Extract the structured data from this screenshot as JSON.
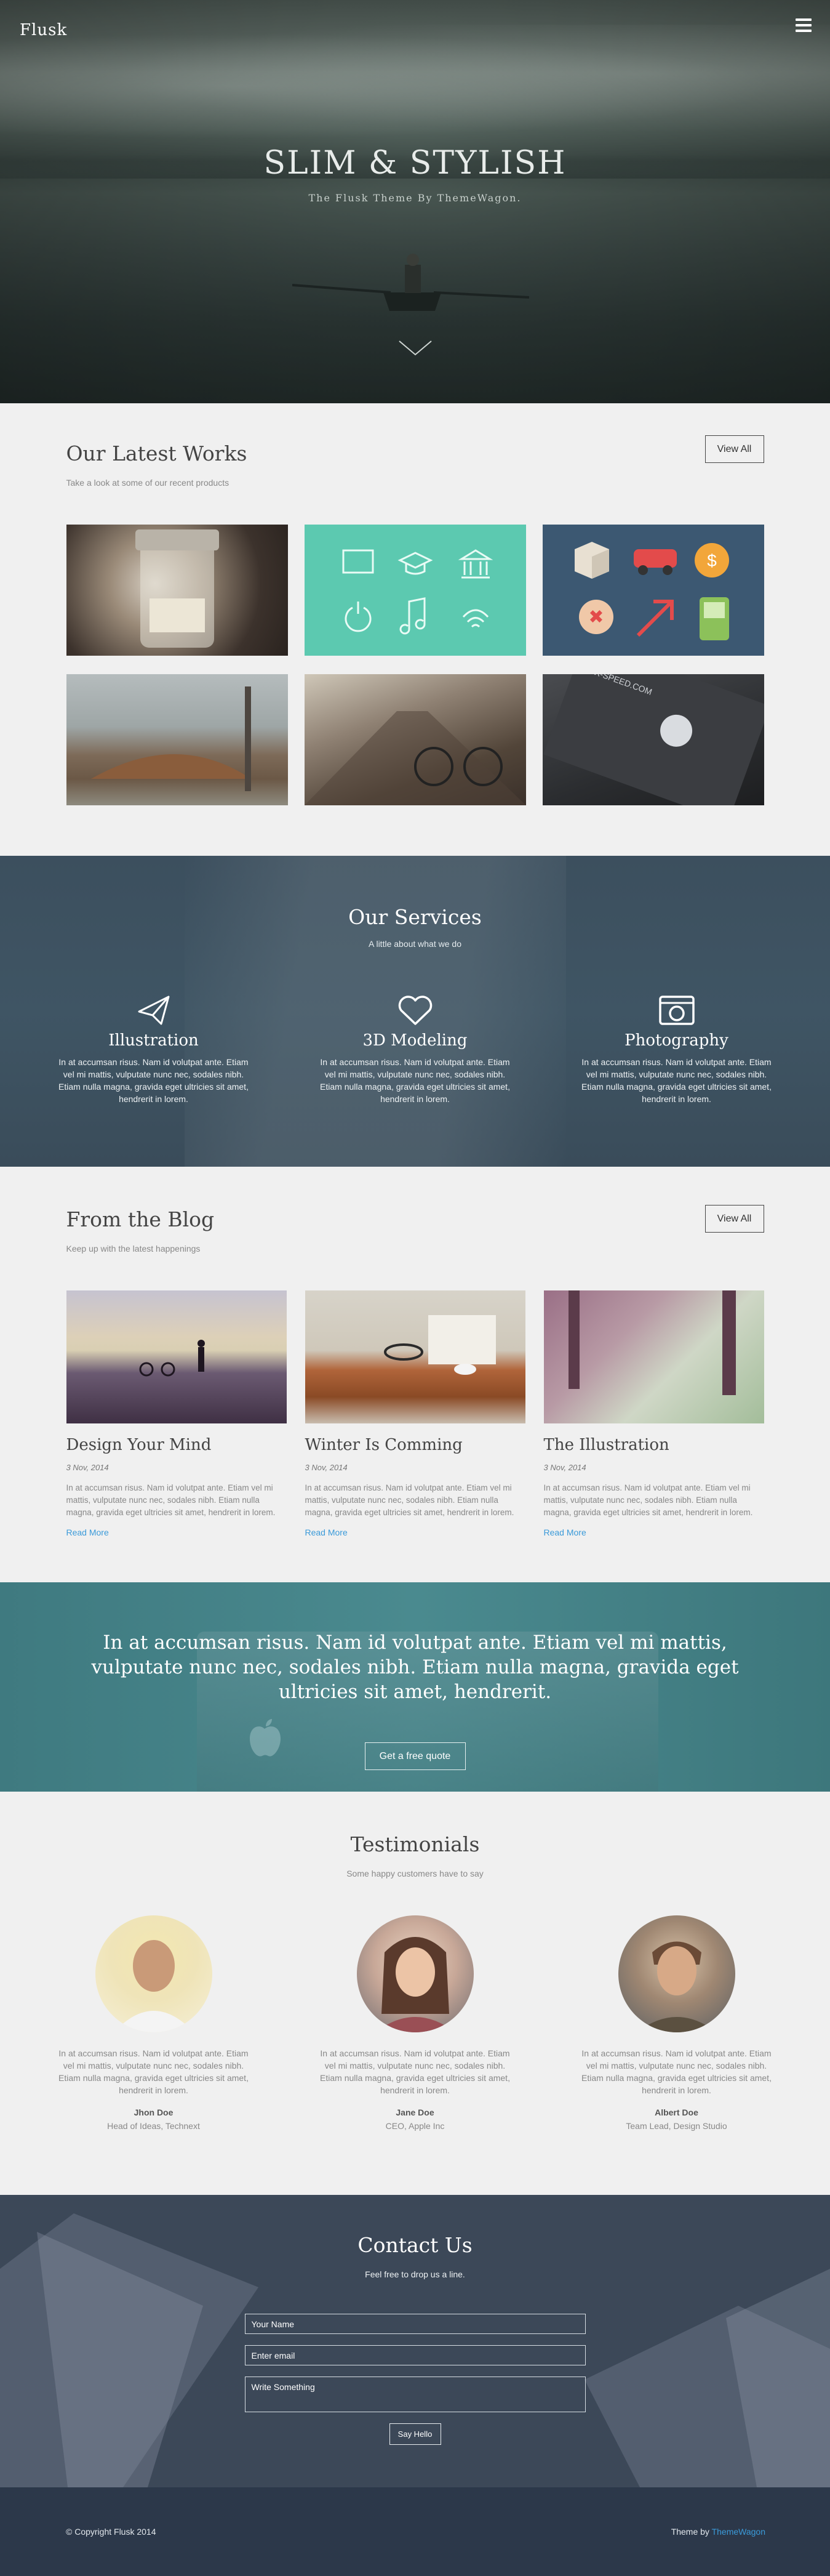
{
  "header": {
    "logo": "Flusk"
  },
  "hero": {
    "title": "SLIM & STYLISH",
    "subtitle": "The Flusk Theme By ThemeWagon."
  },
  "works": {
    "title": "Our Latest Works",
    "subtitle": "Take a look at some of our recent products",
    "view_all": "View All",
    "tile6_text": "BIX-SPEED.COM"
  },
  "services": {
    "title": "Our Services",
    "subtitle": "A little about what we do",
    "items": [
      {
        "title": "Illustration",
        "icon": "paper-plane-icon",
        "text": "In at accumsan risus. Nam id volutpat ante. Etiam vel mi mattis, vulputate nunc nec, sodales nibh. Etiam nulla magna, gravida eget ultricies sit amet, hendrerit in lorem."
      },
      {
        "title": "3D Modeling",
        "icon": "heart-icon",
        "text": "In at accumsan risus. Nam id volutpat ante. Etiam vel mi mattis, vulputate nunc nec, sodales nibh. Etiam nulla magna, gravida eget ultricies sit amet, hendrerit in lorem."
      },
      {
        "title": "Photography",
        "icon": "camera-icon",
        "text": "In at accumsan risus. Nam id volutpat ante. Etiam vel mi mattis, vulputate nunc nec, sodales nibh. Etiam nulla magna, gravida eget ultricies sit amet, hendrerit in lorem."
      }
    ]
  },
  "blog": {
    "title": "From the Blog",
    "subtitle": "Keep up with the latest happenings",
    "view_all": "View All",
    "posts": [
      {
        "title": "Design Your Mind",
        "date": "3 Nov, 2014",
        "text": "In at accumsan risus. Nam id volutpat ante. Etiam vel mi mattis, vulputate nunc nec, sodales nibh. Etiam nulla magna, gravida eget ultricies sit amet, hendrerit in lorem.",
        "link": "Read More"
      },
      {
        "title": "Winter Is Comming",
        "date": "3 Nov, 2014",
        "text": "In at accumsan risus. Nam id volutpat ante. Etiam vel mi mattis, vulputate nunc nec, sodales nibh. Etiam nulla magna, gravida eget ultricies sit amet, hendrerit in lorem.",
        "link": "Read More"
      },
      {
        "title": "The Illustration",
        "date": "3 Nov, 2014",
        "text": "In at accumsan risus. Nam id volutpat ante. Etiam vel mi mattis, vulputate nunc nec, sodales nibh. Etiam nulla magna, gravida eget ultricies sit amet, hendrerit in lorem.",
        "link": "Read More"
      }
    ]
  },
  "quote": {
    "text": "In at accumsan risus. Nam id volutpat ante. Etiam vel mi mattis, vulputate nunc nec, sodales nibh. Etiam nulla magna, gravida eget ultricies sit amet, hendrerit.",
    "button": "Get a free quote"
  },
  "testimonials": {
    "title": "Testimonials",
    "subtitle": "Some happy customers have to say",
    "items": [
      {
        "text": "In at accumsan risus. Nam id volutpat ante. Etiam vel mi mattis, vulputate nunc nec, sodales nibh. Etiam nulla magna, gravida eget ultricies sit amet, hendrerit in lorem.",
        "name": "Jhon Doe",
        "role": "Head of Ideas, Technext"
      },
      {
        "text": "In at accumsan risus. Nam id volutpat ante. Etiam vel mi mattis, vulputate nunc nec, sodales nibh. Etiam nulla magna, gravida eget ultricies sit amet, hendrerit in lorem.",
        "name": "Jane Doe",
        "role": "CEO, Apple Inc"
      },
      {
        "text": "In at accumsan risus. Nam id volutpat ante. Etiam vel mi mattis, vulputate nunc nec, sodales nibh. Etiam nulla magna, gravida eget ultricies sit amet, hendrerit in lorem.",
        "name": "Albert Doe",
        "role": "Team Lead, Design Studio"
      }
    ]
  },
  "contact": {
    "title": "Contact Us",
    "subtitle": "Feel free to drop us a line.",
    "name_placeholder": "Your Name",
    "email_placeholder": "Enter email",
    "message_placeholder": "Write Something",
    "submit": "Say Hello"
  },
  "footer": {
    "copyright": "© Copyright Flusk 2014",
    "credit_prefix": "Theme by ",
    "credit_link": "ThemeWagon"
  },
  "colors": {
    "accent_link": "#3a9ad9",
    "services_bg": "#3c4f5e",
    "quote_bg": "#4a8a8f",
    "contact_bg": "#3c4858",
    "footer_bg": "#2c384a"
  }
}
